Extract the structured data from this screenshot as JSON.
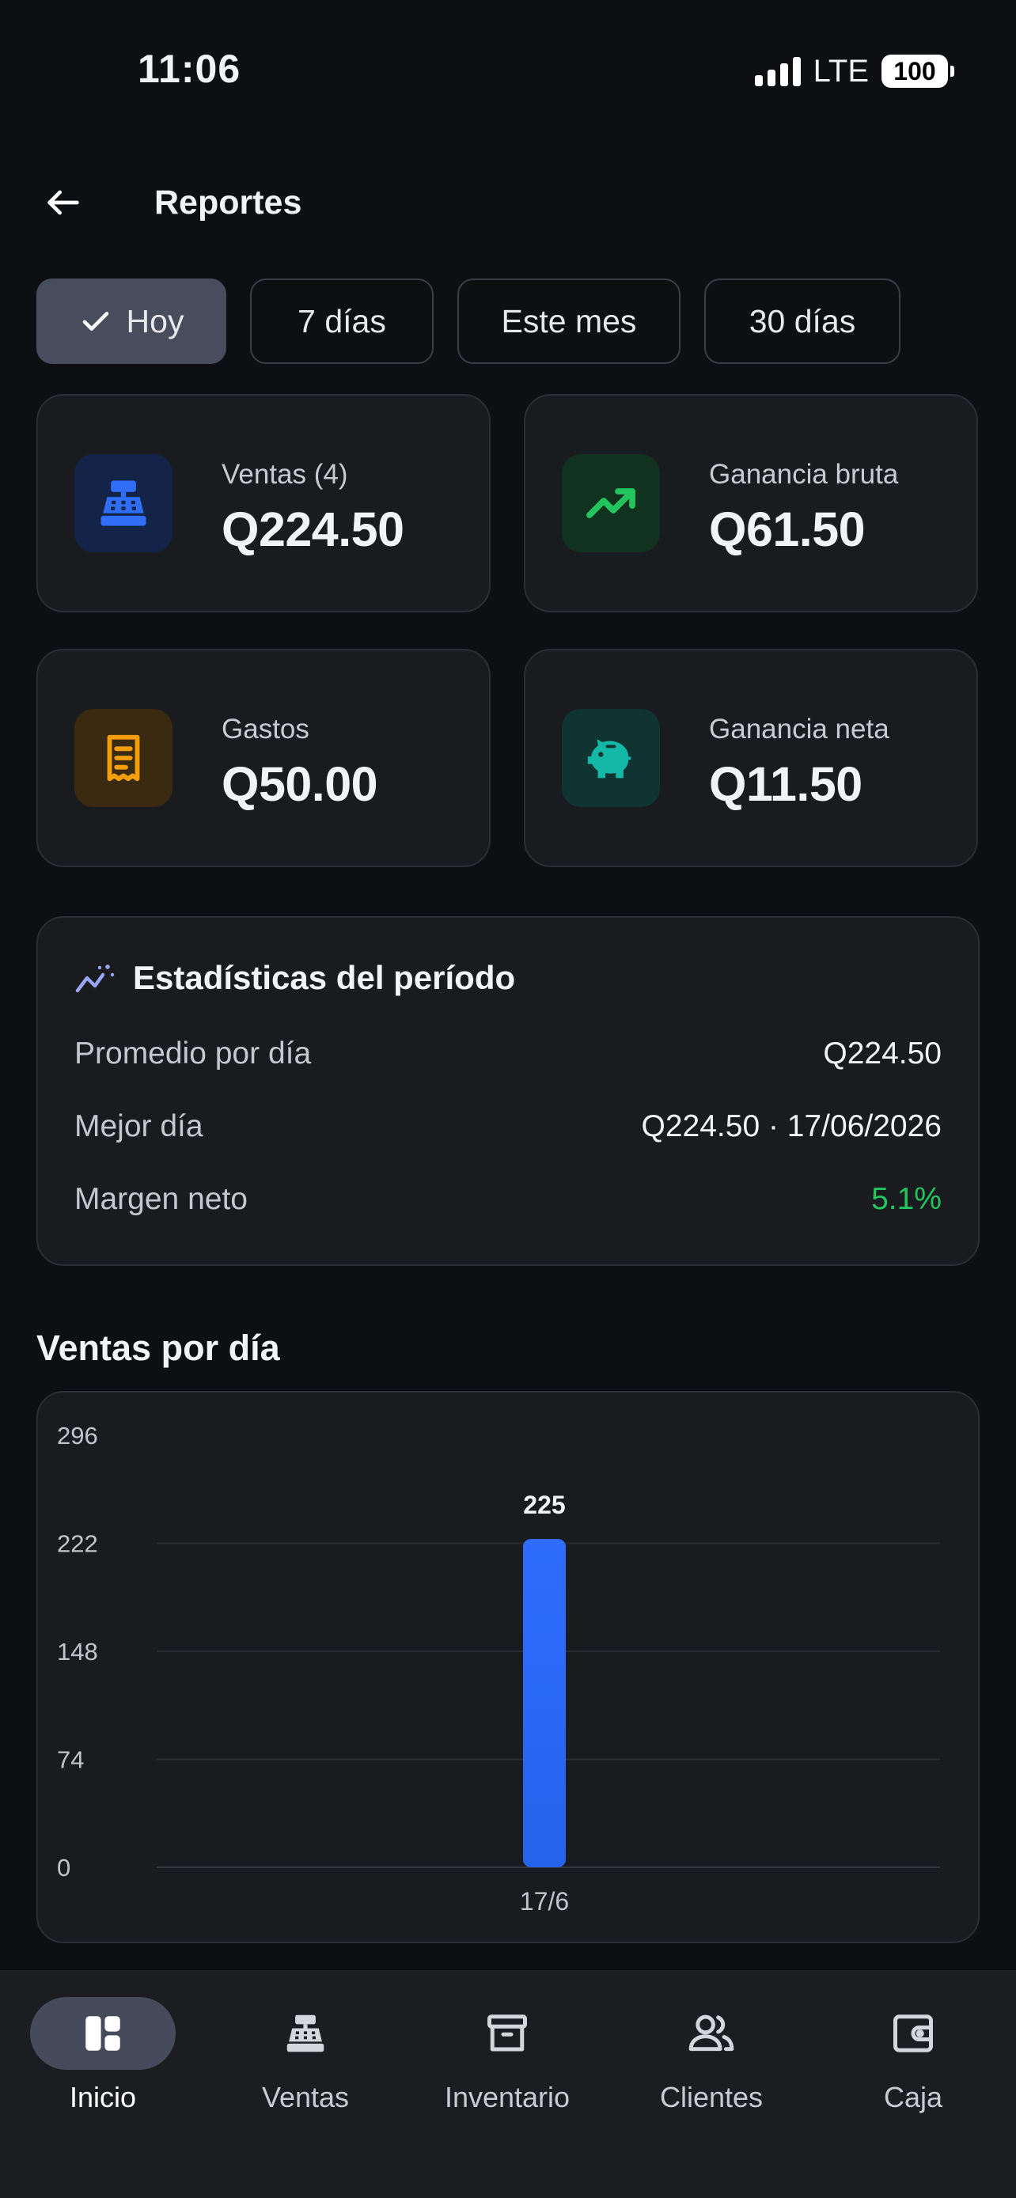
{
  "status_bar": {
    "time": "11:06",
    "network": "LTE",
    "battery": "100"
  },
  "header": {
    "title": "Reportes"
  },
  "filters": [
    {
      "label": "Hoy",
      "active": true
    },
    {
      "label": "7 días",
      "active": false
    },
    {
      "label": "Este mes",
      "active": false
    },
    {
      "label": "30 días",
      "active": false
    }
  ],
  "cards": {
    "ventas": {
      "label": "Ventas (4)",
      "value": "Q224.50",
      "icon": "cash-register-icon",
      "color": "#2563eb"
    },
    "ganancia_bruta": {
      "label": "Ganancia bruta",
      "value": "Q61.50",
      "icon": "trending-up-icon",
      "color": "#22c55e"
    },
    "gastos": {
      "label": "Gastos",
      "value": "Q50.00",
      "icon": "receipt-icon",
      "color": "#f59e0b"
    },
    "ganancia_neta": {
      "label": "Ganancia neta",
      "value": "Q11.50",
      "icon": "piggy-bank-icon",
      "color": "#14b8a6"
    }
  },
  "period_stats": {
    "title": "Estadísticas del período",
    "rows": [
      {
        "label": "Promedio por día",
        "value": "Q224.50"
      },
      {
        "label": "Mejor día",
        "value": "Q224.50 · 17/06/2026"
      },
      {
        "label": "Margen neto",
        "value": "5.1%"
      }
    ]
  },
  "chart_section": {
    "title": "Ventas por día"
  },
  "chart_data": {
    "type": "bar",
    "categories": [
      "17/6"
    ],
    "values": [
      225
    ],
    "data_labels": [
      "225"
    ],
    "y_ticks": [
      0,
      74,
      148,
      222,
      296
    ],
    "ylim": [
      0,
      296
    ],
    "grid": true,
    "bar_color": "#2563eb"
  },
  "bottom_nav": [
    {
      "label": "Inicio",
      "icon": "dashboard-icon",
      "active": true
    },
    {
      "label": "Ventas",
      "icon": "cash-register-icon",
      "active": false
    },
    {
      "label": "Inventario",
      "icon": "archive-box-icon",
      "active": false
    },
    {
      "label": "Clientes",
      "icon": "users-icon",
      "active": false
    },
    {
      "label": "Caja",
      "icon": "wallet-icon",
      "active": false
    }
  ]
}
